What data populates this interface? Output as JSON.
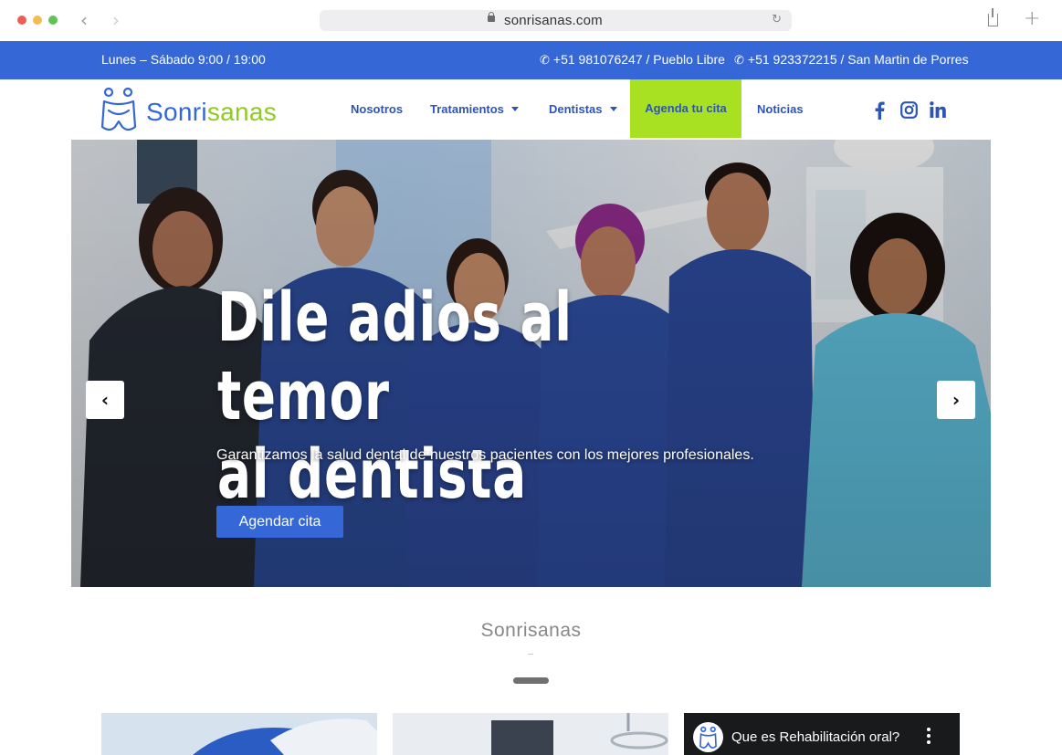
{
  "browser": {
    "url": "sonrisanas.com",
    "back_icon": "chevron-left-icon",
    "forward_icon": "chevron-right-icon"
  },
  "topbar": {
    "hours": "Lunes – Sábado 9:00 / 19:00",
    "phone1": "+51 981076247 / Pueblo Libre",
    "phone2": "+51 923372215 / San Martin de Porres"
  },
  "header": {
    "logo_part1": "Sonri",
    "logo_part2": "sanas",
    "nav": {
      "nosotros": "Nosotros",
      "tratamientos": "Tratamientos",
      "dentistas": "Dentistas",
      "agenda": "Agenda tu cita",
      "noticias": "Noticias"
    },
    "social": [
      "facebook-icon",
      "instagram-icon",
      "linkedin-icon"
    ]
  },
  "hero": {
    "title_line1": "Dile adios al temor",
    "title_line2": "al dentista",
    "subtitle": "Garantizamos la salud dental de nuestros pacientes con los mejores profesionales.",
    "button": "Agendar cita"
  },
  "section": {
    "title": "Sonrisanas"
  },
  "cards": {
    "video_title": "Que es Rehabilitación oral?"
  },
  "colors": {
    "brand_blue": "#3567d6",
    "brand_green": "#a8e022"
  }
}
